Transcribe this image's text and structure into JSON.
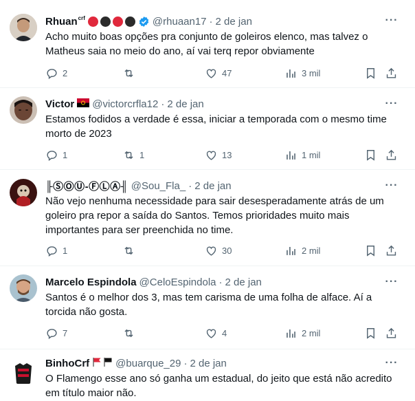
{
  "colors": {
    "text": "#0f1419",
    "muted": "#536471",
    "verified": "#1d9bf0",
    "divider": "#eff3f4",
    "badge_red": "#e0283c",
    "badge_black": "#2b2b2b"
  },
  "tweets": [
    {
      "name": "Rhuan",
      "name_sup": "crf",
      "handle": "@rhuaan17",
      "time": "2 de jan",
      "text": "Acho muito boas opções pra conjunto de goleiros elenco, mas talvez o Matheus saia no meio do ano, aí vai terq repor obviamente",
      "replies": "2",
      "retweets": "",
      "likes": "47",
      "views": "3 mil"
    },
    {
      "name": "Victor",
      "handle": "@victorcrfla12",
      "time": "2 de jan",
      "text": "Estamos fodidos a verdade é essa, iniciar a temporada com o mesmo time morto de 2023",
      "replies": "1",
      "retweets": "1",
      "likes": "13",
      "views": "1 mil"
    },
    {
      "name": "╟ⓈⓄⓊ-ⒻⓁⒶ╢",
      "handle": "@Sou_Fla_",
      "time": "2 de jan",
      "text": "Não vejo nenhuma necessidade para sair desesperadamente atrás de um goleiro pra repor a saída do Santos. Temos prioridades muito mais importantes para ser preenchida no time.",
      "replies": "1",
      "retweets": "",
      "likes": "30",
      "views": "2 mil"
    },
    {
      "name": "Marcelo Espindola",
      "handle": "@CeloEspindola",
      "time": "2 de jan",
      "text": "Santos é o melhor dos 3, mas tem carisma de uma folha de alface. Aí a torcida não gosta.",
      "replies": "7",
      "retweets": "",
      "likes": "4",
      "views": "2 mil"
    },
    {
      "name": "BinhoCrf",
      "handle": "@buarque_29",
      "time": "2 de jan",
      "text": "O Flamengo esse ano só ganha um estadual, do jeito que está não acredito em título maior não."
    }
  ]
}
